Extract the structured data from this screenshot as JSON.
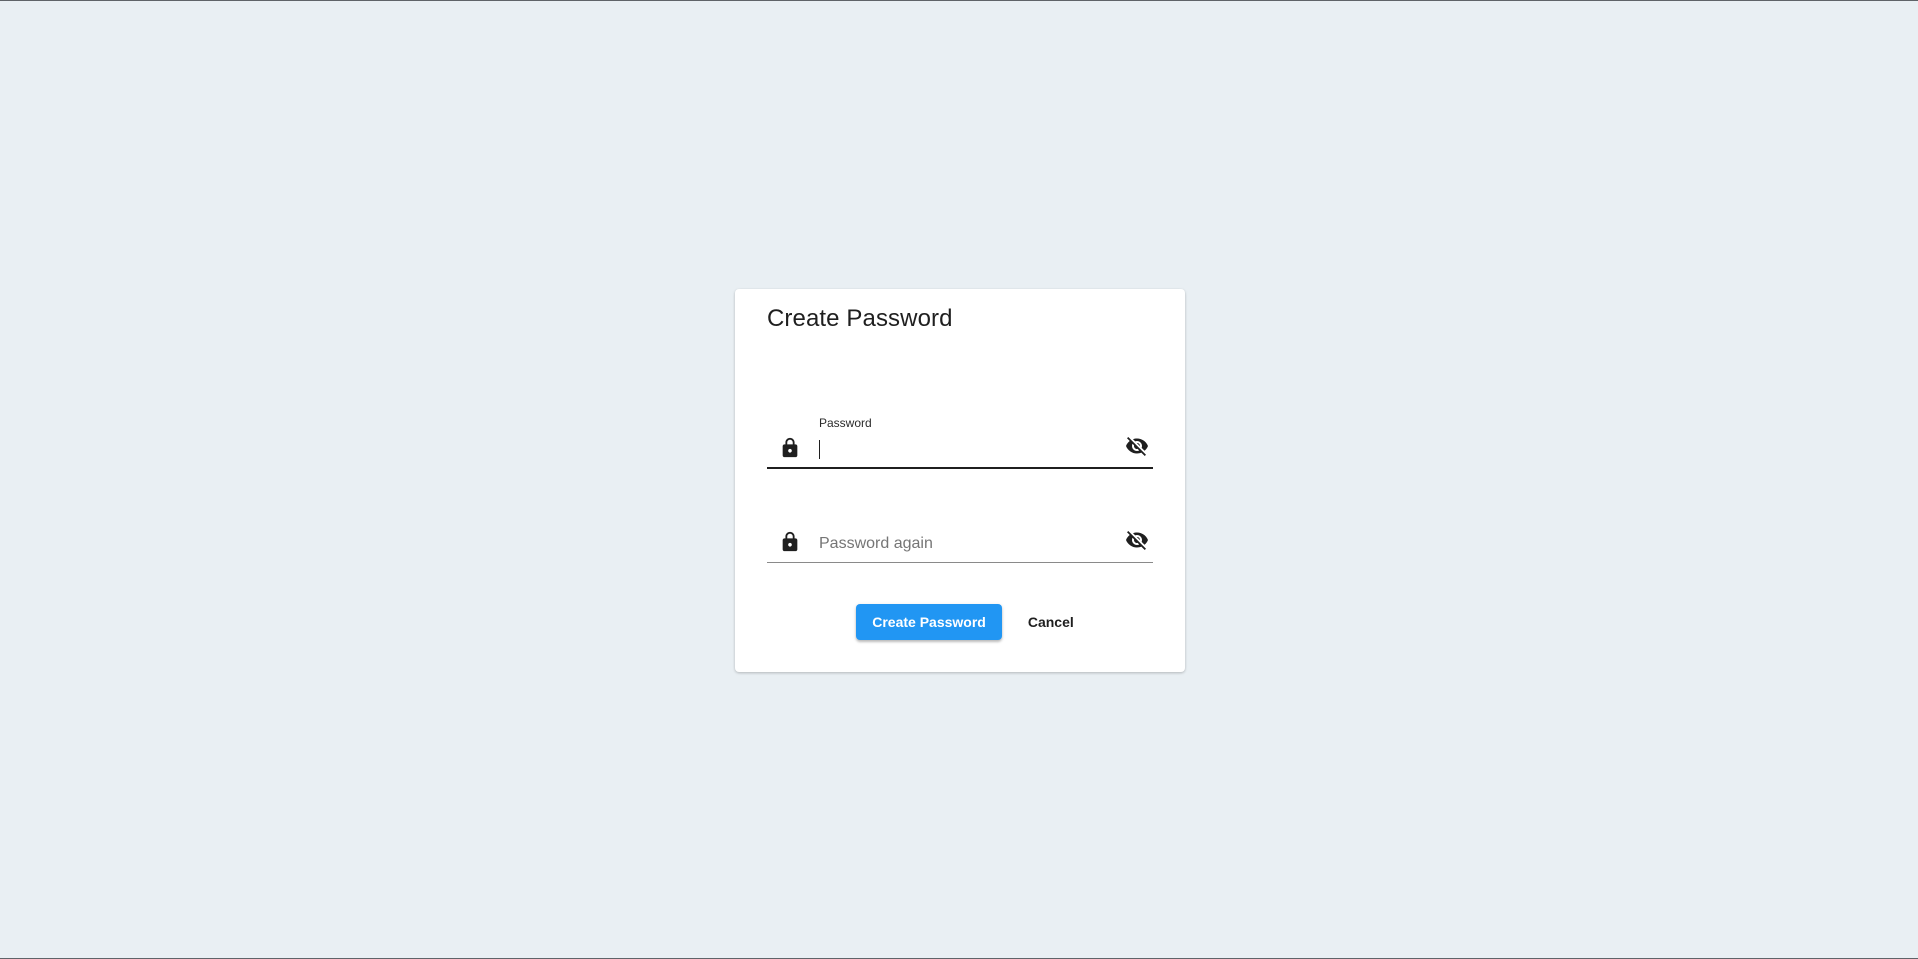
{
  "dialog": {
    "title": "Create Password",
    "password_field": {
      "label": "Password",
      "value": "",
      "placeholder": "",
      "lead_icon": "lock-icon",
      "trail_icon": "eye-off-icon"
    },
    "password_again_field": {
      "label": "",
      "value": "",
      "placeholder": "Password again",
      "lead_icon": "lock-icon",
      "trail_icon": "eye-off-icon"
    },
    "actions": {
      "create_label": "Create Password",
      "cancel_label": "Cancel"
    }
  },
  "colors": {
    "background": "#e9eff3",
    "primary": "#2196f3",
    "surface": "#ffffff",
    "text": "#1f1f1f"
  }
}
